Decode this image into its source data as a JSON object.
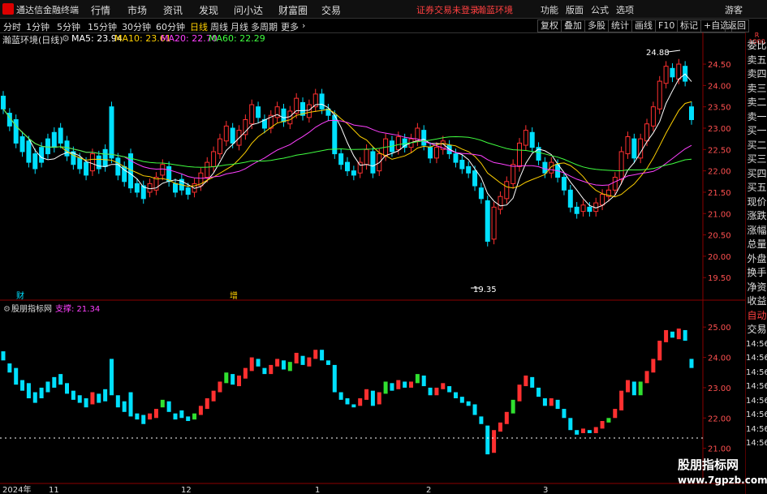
{
  "app": {
    "title": "通达信金融终端"
  },
  "menu": [
    "行情",
    "市场",
    "资讯",
    "发现",
    "问小达",
    "财富圈",
    "交易"
  ],
  "warning": {
    "left": "证券交易未登录",
    "right": "瀚蓝环境"
  },
  "right_menu": [
    "功能",
    "版面",
    "公式",
    "选项"
  ],
  "guest": "游客",
  "periods": [
    "分时",
    "1分钟",
    "5分钟",
    "15分钟",
    "30分钟",
    "60分钟",
    "日线",
    "周线",
    "月线",
    "多周期",
    "更多"
  ],
  "toolbar": [
    "复权",
    "叠加",
    "多股",
    "统计",
    "画线",
    "F10",
    "标记",
    "+自选",
    "返回"
  ],
  "main_chart": {
    "name": "瀚蓝环境(日线)",
    "ma": [
      {
        "label": "MA5: 23.94",
        "color": "#ffffff"
      },
      {
        "label": "MA10: 23.61",
        "color": "#ffd000"
      },
      {
        "label": "MA20: 22.70",
        "color": "#ff40ff"
      },
      {
        "label": "MA60: 22.29",
        "color": "#40ff40"
      }
    ],
    "high_label": "24.88",
    "low_label": "19.35",
    "yticks": [
      "24.50",
      "24.00",
      "23.50",
      "23.00",
      "22.50",
      "22.00",
      "21.50",
      "21.00",
      "20.50",
      "20.00",
      "19.50"
    ],
    "markers": [
      "财",
      "增"
    ]
  },
  "sub_chart": {
    "name": "股朋指标网",
    "support": "支撑: 21.34",
    "yticks": [
      "25.00",
      "24.00",
      "23.00",
      "22.00",
      "21.00"
    ]
  },
  "x_axis": [
    "2024年",
    "11",
    "12",
    "1",
    "2",
    "3"
  ],
  "side_panel": [
    "委比",
    "卖五",
    "卖四",
    "卖三",
    "卖二",
    "卖一",
    "买一",
    "买二",
    "买三",
    "买四",
    "买五",
    "现价",
    "涨跌",
    "涨幅",
    "总量",
    "外盘",
    "换手",
    "净资",
    "收益",
    "自动",
    "交易"
  ],
  "side_times": [
    "14:56",
    "14:56",
    "14:56",
    "14:56",
    "14:56",
    "14:56",
    "14:56",
    "14:56"
  ],
  "watermark": {
    "name": "股朋指标网",
    "url": "www.7gpzb.com"
  },
  "colors": {
    "up": "#ff3030",
    "down": "#00e0ff",
    "ma5": "#ffffff",
    "ma10": "#ffd000",
    "ma20": "#ff40ff",
    "ma60": "#40ff40",
    "grid": "#8b0000"
  },
  "chart_data": {
    "type": "candlestick",
    "candles": [
      [
        23.75,
        23.45
      ],
      [
        23.35,
        23.05
      ],
      [
        23.2,
        22.65
      ],
      [
        22.8,
        22.45
      ],
      [
        22.7,
        22.2
      ],
      [
        22.4,
        22.05
      ],
      [
        22.55,
        22.2
      ],
      [
        22.75,
        22.4
      ],
      [
        22.9,
        22.55
      ],
      [
        23.0,
        22.65
      ],
      [
        22.7,
        22.35
      ],
      [
        22.45,
        22.15
      ],
      [
        22.3,
        22.05
      ],
      [
        22.2,
        21.9
      ],
      [
        22.0,
        22.4
      ],
      [
        22.35,
        22.05
      ],
      [
        22.5,
        22.1
      ],
      [
        23.5,
        22.3
      ],
      [
        22.3,
        21.9
      ],
      [
        22.1,
        21.75
      ],
      [
        22.4,
        21.6
      ],
      [
        21.7,
        21.5
      ],
      [
        21.65,
        21.35
      ],
      [
        21.5,
        21.7
      ],
      [
        21.55,
        21.85
      ],
      [
        21.9,
        22.15
      ],
      [
        22.1,
        21.75
      ],
      [
        21.7,
        21.5
      ],
      [
        21.8,
        21.55
      ],
      [
        21.6,
        21.45
      ],
      [
        21.5,
        21.7
      ],
      [
        21.65,
        21.95
      ],
      [
        21.85,
        22.2
      ],
      [
        22.1,
        22.45
      ],
      [
        22.4,
        22.75
      ],
      [
        22.7,
        23.05
      ],
      [
        23.0,
        22.65
      ],
      [
        22.6,
        22.95
      ],
      [
        22.85,
        23.2
      ],
      [
        23.1,
        23.55
      ],
      [
        23.5,
        23.25
      ],
      [
        23.2,
        23.0
      ],
      [
        23.0,
        23.3
      ],
      [
        23.25,
        23.5
      ],
      [
        23.45,
        23.15
      ],
      [
        23.1,
        23.4
      ],
      [
        23.35,
        23.7
      ],
      [
        23.6,
        23.3
      ],
      [
        23.25,
        23.55
      ],
      [
        23.5,
        23.8
      ],
      [
        23.8,
        23.45
      ],
      [
        23.45,
        23.3
      ],
      [
        23.3,
        22.4
      ],
      [
        22.4,
        22.15
      ],
      [
        22.2,
        22.0
      ],
      [
        22.0,
        21.9
      ],
      [
        21.95,
        22.2
      ],
      [
        22.15,
        22.5
      ],
      [
        22.45,
        21.95
      ],
      [
        22.0,
        22.4
      ],
      [
        22.35,
        22.75
      ],
      [
        22.7,
        22.45
      ],
      [
        22.5,
        22.8
      ],
      [
        22.75,
        22.55
      ],
      [
        22.55,
        22.75
      ],
      [
        22.7,
        23.0
      ],
      [
        22.95,
        22.6
      ],
      [
        22.55,
        22.3
      ],
      [
        22.3,
        22.55
      ],
      [
        22.5,
        22.7
      ],
      [
        22.6,
        22.4
      ],
      [
        22.4,
        22.2
      ],
      [
        22.25,
        22.05
      ],
      [
        22.1,
        21.95
      ],
      [
        22.0,
        21.65
      ],
      [
        21.6,
        21.35
      ],
      [
        21.3,
        20.35
      ],
      [
        20.4,
        21.15
      ],
      [
        21.1,
        21.4
      ],
      [
        21.35,
        21.75
      ],
      [
        21.7,
        22.15
      ],
      [
        22.1,
        22.65
      ],
      [
        22.6,
        22.95
      ],
      [
        22.9,
        22.55
      ],
      [
        22.55,
        22.25
      ],
      [
        22.2,
        21.95
      ],
      [
        21.95,
        22.2
      ],
      [
        22.15,
        21.85
      ],
      [
        21.85,
        21.55
      ],
      [
        21.55,
        21.15
      ],
      [
        21.15,
        21.0
      ],
      [
        21.05,
        21.2
      ],
      [
        21.15,
        21.05
      ],
      [
        21.05,
        21.25
      ],
      [
        21.2,
        21.45
      ],
      [
        21.4,
        21.55
      ],
      [
        21.55,
        21.85
      ],
      [
        21.8,
        22.45
      ],
      [
        22.4,
        22.8
      ],
      [
        22.75,
        22.3
      ],
      [
        22.3,
        22.75
      ],
      [
        22.7,
        23.1
      ],
      [
        23.05,
        23.5
      ],
      [
        23.45,
        24.1
      ],
      [
        24.05,
        24.45
      ],
      [
        24.4,
        24.2
      ],
      [
        24.15,
        24.5
      ],
      [
        24.45,
        24.1
      ],
      [
        23.5,
        23.2
      ]
    ],
    "ylim": [
      19.2,
      24.9
    ],
    "sub_ylim": [
      20.0,
      25.3
    ],
    "support_level": 21.34
  }
}
